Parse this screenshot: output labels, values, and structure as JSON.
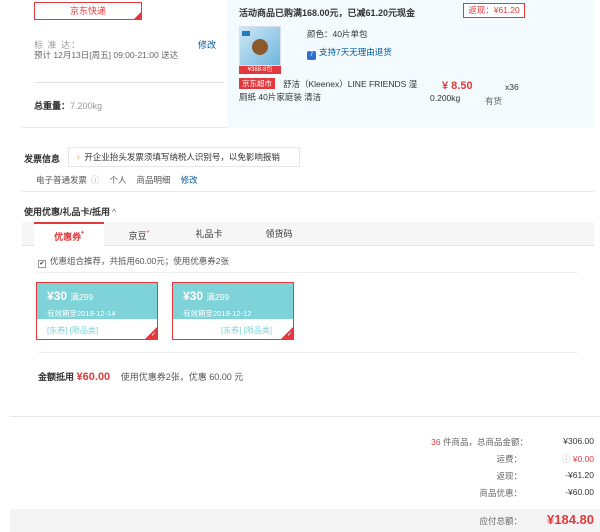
{
  "shipping": {
    "method": "京东快递",
    "standard_label": "标 准 达：",
    "modify": "修改",
    "eta": "预计 12月13日[周五] 09:00-21:00 送达",
    "weight_label": "总重量：",
    "weight_value": "7.200kg"
  },
  "goods": {
    "promo": "活动商品已购满168.00元，已减61.20元现金",
    "rebate": "返现：¥61.20",
    "img_strip": "¥388-8包",
    "color": "颜色：40片单包",
    "return_policy": "支持7天无理由退货",
    "shop_tag": "京东超市",
    "name": "舒洁（Kleenex）LINE FRIENDS 湿厕纸 40片家庭装 清洁",
    "price": "¥ 8.50",
    "quantity": "x36",
    "item_weight": "0.200kg",
    "stock": "有货"
  },
  "invoice": {
    "title": "发票信息",
    "tip": "开企业抬头发票须填写纳税人识别号，以免影响报销",
    "type": "电子普通发票",
    "person": "个人",
    "detail": "商品明细",
    "modify": "修改"
  },
  "coupons": {
    "title": "使用优惠/礼品卡/抵用",
    "chevron": "^",
    "tabs": [
      {
        "label": "优惠券",
        "star": "*"
      },
      {
        "label": "京豆",
        "star": "*"
      },
      {
        "label": "礼品卡",
        "star": ""
      },
      {
        "label": "领货码",
        "star": ""
      }
    ],
    "recommend": "优惠组合推荐，共抵用60.00元；使用优惠券2张",
    "cards": [
      {
        "amount": "¥30",
        "condition": "满299",
        "valid": "有效期至2019-12-14",
        "scope": "[东券] [限品类]"
      },
      {
        "amount": "¥30",
        "condition": "满299",
        "valid": "有效期至2019-12-12",
        "scope": "[东券] [限品类]"
      }
    ],
    "deduct_label": "金额抵用",
    "deduct_value": "¥60.00",
    "deduct_note": "使用优惠券2张，优惠 60.00 元"
  },
  "summary": {
    "count": "36",
    "count_label": "件商品，总商品金额：",
    "total_goods": "¥306.00",
    "freight_label": "运费：",
    "freight_value": "¥0.00",
    "rebate_label": "返现：",
    "rebate_value": "-¥61.20",
    "discount_label": "商品优惠：",
    "discount_value": "-¥60.00",
    "payable_label": "应付总额：",
    "payable_value": "¥184.80"
  },
  "colors": {
    "accent": "#e4393c",
    "link": "#005aa0",
    "coupon": "#7dd3d8"
  }
}
